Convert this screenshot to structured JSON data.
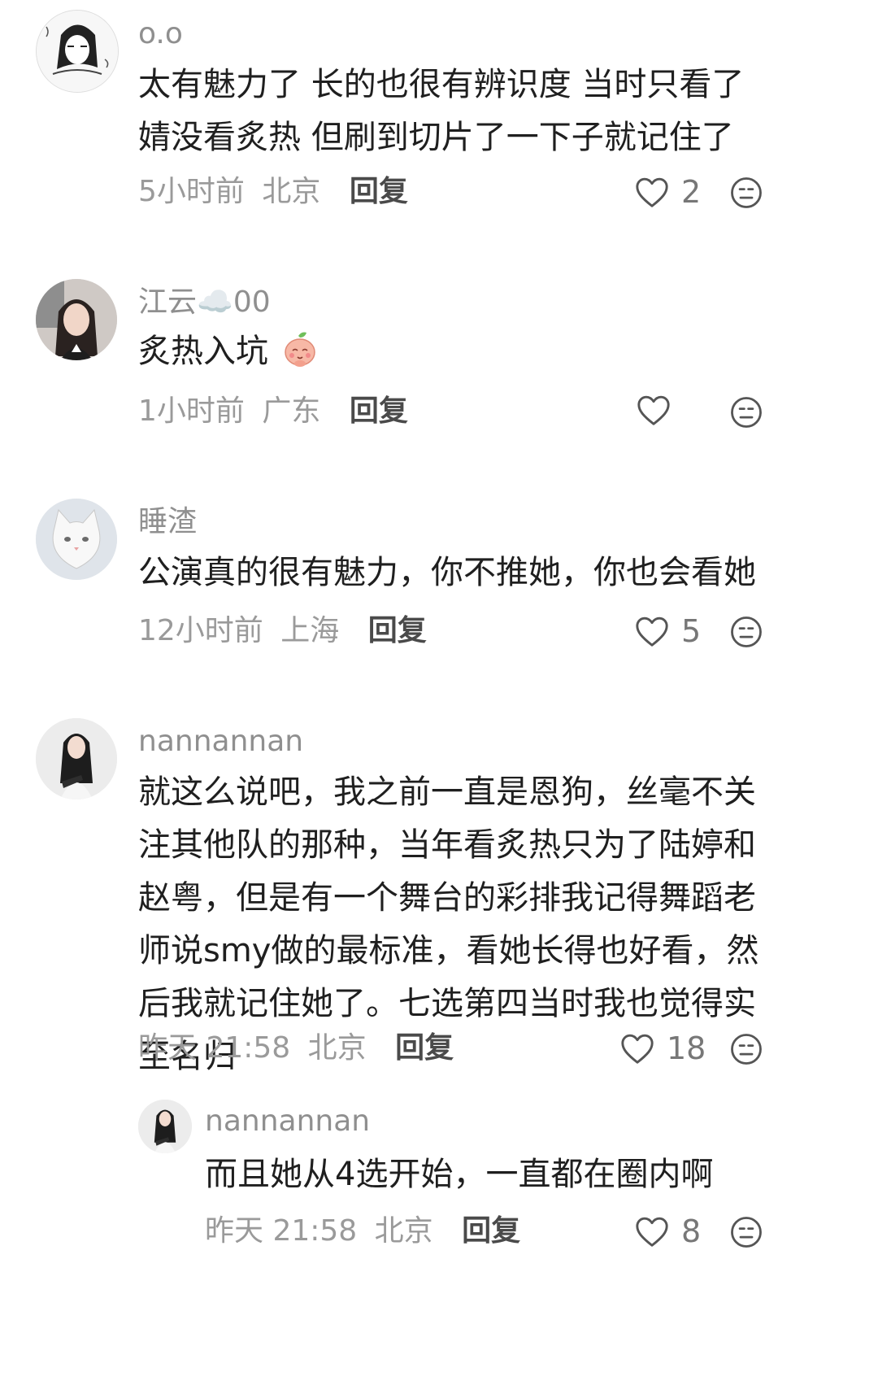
{
  "comments": [
    {
      "username": "o.o",
      "text": "太有魅力了 长的也很有辨识度 当时只看了婧没看炙热 但刷到切片了一下子就记住了",
      "time": "5小时前",
      "location": "北京",
      "reply": "回复",
      "likes": "2",
      "avatar_icon": "anime-sketch-avatar"
    },
    {
      "username": "江云☁️00",
      "text": "炙热入坑",
      "time": "1小时前",
      "location": "广东",
      "reply": "回复",
      "likes": "",
      "avatar_icon": "girl-photo-avatar"
    },
    {
      "username": "睡渣",
      "text": "公演真的很有魅力，你不推她，你也会看她",
      "time": "12小时前",
      "location": "上海",
      "reply": "回复",
      "likes": "5",
      "avatar_icon": "white-cat-avatar"
    },
    {
      "username": "nannannan",
      "text": "就这么说吧，我之前一直是恩狗，丝毫不关注其他队的那种，当年看炙热只为了陆婷和赵粤，但是有一个舞台的彩排我记得舞蹈老师说smy做的最标准，看她长得也好看，然后我就记住她了。七选第四当时我也觉得实至名归",
      "time": "昨天 21:58",
      "location": "北京",
      "reply": "回复",
      "likes": "18",
      "avatar_icon": "girl-portrait-avatar"
    }
  ],
  "reply": {
    "username": "nannannan",
    "text": "而且她从4选开始，一直都在圈内啊",
    "time": "昨天 21:58",
    "location": "北京",
    "reply": "回复",
    "likes": "8"
  },
  "colors": {
    "text": "#1f1f1f",
    "meta": "#9a9a9a",
    "username": "#8f8f8f"
  }
}
